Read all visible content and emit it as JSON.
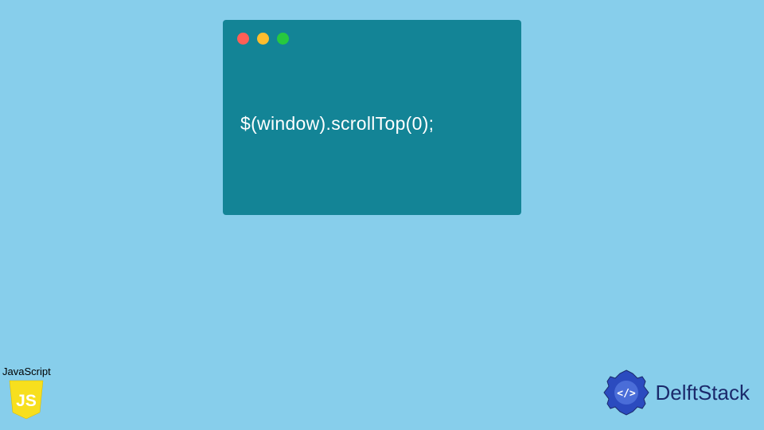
{
  "code_window": {
    "traffic_lights": [
      "red",
      "yellow",
      "green"
    ],
    "code": "$(window).scrollTop(0);"
  },
  "js_badge": {
    "label": "JavaScript",
    "shield_text": "JS",
    "shield_color": "#f7df1e"
  },
  "brand": {
    "name": "DelftStack",
    "logo_symbol": "</>",
    "logo_color": "#2b4bbf"
  },
  "colors": {
    "background": "#87ceeb",
    "window": "#138496"
  }
}
